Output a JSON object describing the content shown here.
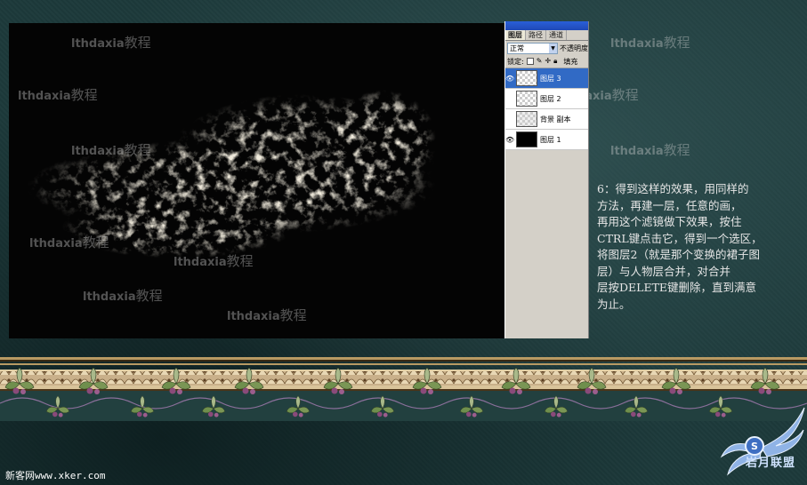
{
  "watermark": {
    "latin": "lthdaxia",
    "cjk": "教程"
  },
  "layers_panel": {
    "tabs": [
      "图层",
      "路径",
      "通道"
    ],
    "blend_mode": "正常",
    "opacity_label": "不透明度",
    "lock_label": "锁定:",
    "fill_label": "填充",
    "layers": [
      {
        "name": "图层 3",
        "visible": true,
        "selected": true,
        "thumb": "transparent"
      },
      {
        "name": "图层 2",
        "visible": false,
        "selected": false,
        "thumb": "transparent"
      },
      {
        "name": "背景 副本",
        "visible": false,
        "selected": false,
        "thumb": "sketch"
      },
      {
        "name": "图层 1",
        "visible": true,
        "selected": false,
        "thumb": "black"
      }
    ]
  },
  "description": "6：得到这样的效果，用同样的\n方法，再建一层，任意的画，\n再用这个滤镜做下效果，按住\nCTRL键点击它，得到一个选区，\n将图层2（就是那个变换的裙子图\n层）与人物层合并，对合并\n层按DELETE键删除，直到满意\n为止。",
  "footer": {
    "site": "新客网www.xker.com",
    "logo_text": "岩月联盟"
  },
  "colors": {
    "background": "#1d3a3b",
    "selected_layer": "#316ac5",
    "description_text": "#e6e6e6"
  }
}
